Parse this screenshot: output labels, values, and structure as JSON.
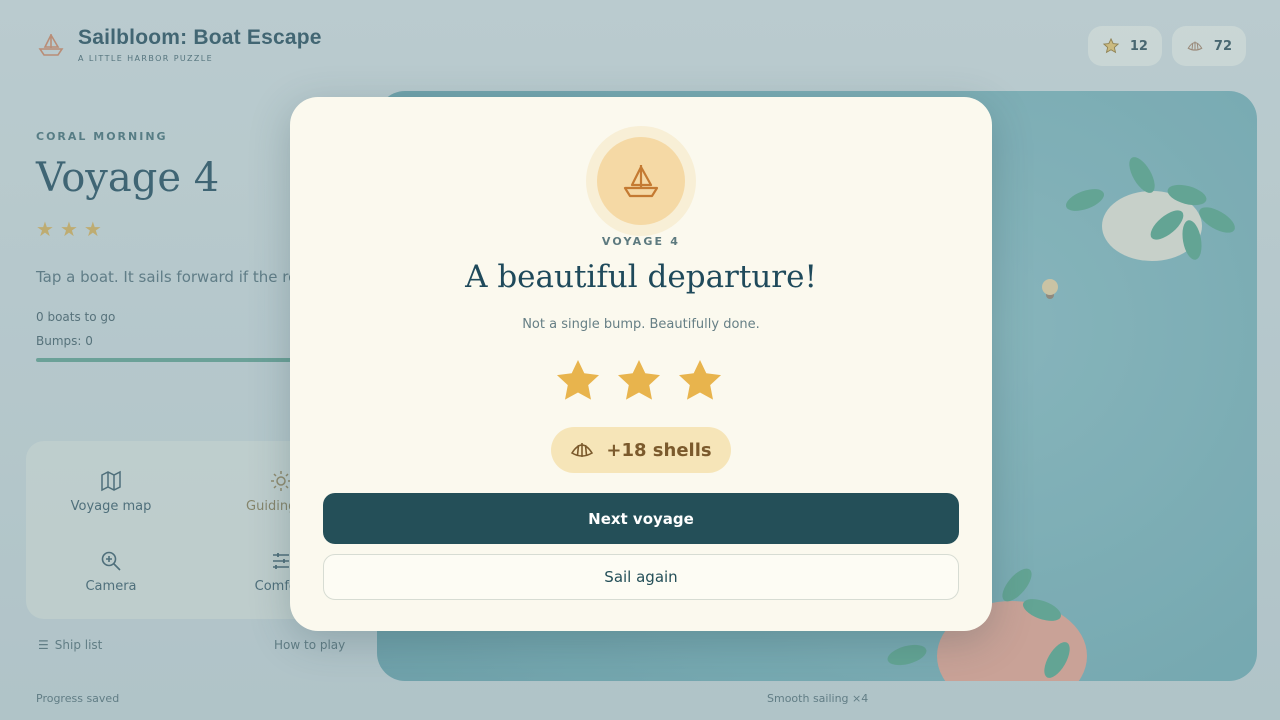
{
  "app": {
    "title": "Sailbloom: Boat Escape",
    "subtitle": "A LITTLE HARBOR PUZZLE"
  },
  "counters": {
    "stars": "12",
    "shells": "72"
  },
  "level": {
    "eyebrow": "CORAL MORNING",
    "title": "Voyage 4",
    "stars_earned": 3,
    "hint": "Tap a boat. It sails forward if the ro clear.",
    "boats_left": "0 boats to go",
    "bumps": "Bumps: 0",
    "progress": 1.0
  },
  "tools": {
    "map": "Voyage map",
    "light": "Guiding lig",
    "camera": "Camera",
    "comfort": "Comfort"
  },
  "links": {
    "ship_list": "Ship list",
    "how_to_play": "How to play"
  },
  "footer": {
    "saved": "Progress saved",
    "streak": "Smooth sailing ×4"
  },
  "modal": {
    "eyebrow": "VOYAGE 4",
    "title": "A beautiful departure!",
    "subtitle": "Not a single bump. Beautifully done.",
    "stars": 3,
    "reward": "+18 shells",
    "primary_button": "Next voyage",
    "secondary_button": "Sail again"
  },
  "colors": {
    "accent_dark": "#244f58",
    "star_gold": "#e8b44d",
    "modal_bg": "#fbf9ee"
  }
}
